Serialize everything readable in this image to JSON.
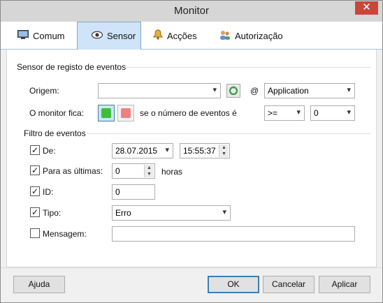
{
  "window": {
    "title": "Monitor",
    "close_glyph": "✕"
  },
  "tabs": [
    {
      "label": "Comum",
      "icon": "monitor-icon"
    },
    {
      "label": "Sensor",
      "icon": "eye-icon",
      "active": true
    },
    {
      "label": "Acções",
      "icon": "bell-icon"
    },
    {
      "label": "Autorização",
      "icon": "users-icon"
    }
  ],
  "sensor": {
    "section_title": "Sensor de registo de eventos",
    "origin_label": "Origem:",
    "origin_value": "",
    "at_symbol": "@",
    "log_value": "Application",
    "monitor_label": "O monitor fica:",
    "monitor_state_colors": {
      "green": "#3dbf3d",
      "red": "#f08080"
    },
    "condition_text": "se o número de eventos é",
    "operator_value": ">=",
    "count_value": "0"
  },
  "filter": {
    "section_title": "Filtro de eventos",
    "from_label": "De:",
    "from_checked": true,
    "from_date": "28.07.2015",
    "from_time": "15:55:37",
    "last_label": "Para as últimas:",
    "last_checked": true,
    "last_value": "0",
    "last_unit": "horas",
    "id_label": "ID:",
    "id_checked": true,
    "id_value": "0",
    "type_label": "Tipo:",
    "type_checked": true,
    "type_value": "Erro",
    "message_label": "Mensagem:",
    "message_checked": false,
    "message_value": ""
  },
  "footer": {
    "help_label": "Ajuda",
    "ok_label": "OK",
    "cancel_label": "Cancelar",
    "apply_label": "Aplicar"
  }
}
